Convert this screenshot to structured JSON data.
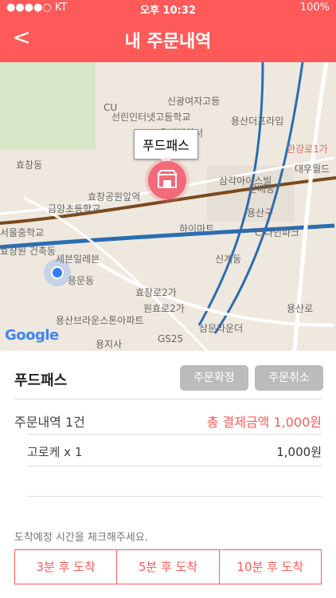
{
  "status_bar": {
    "carrier": "●●●●○ KT",
    "time": "오후 10:32",
    "battery": "100%"
  },
  "header": {
    "back_icon": "<",
    "title": "내 주문내역"
  },
  "map": {
    "place_label": "푸드패스",
    "attribution": "Google",
    "labels": [
      "신광여자고등",
      "선린인터넷고등학교",
      "용산경찰서",
      "용산더프라임",
      "효창동",
      "삼각아이스빌",
      "금양초등학교",
      "효창공원앞역",
      "문배동",
      "용산구",
      "서울중학교",
      "효창원 건축동",
      "세븐일레븐",
      "용문동",
      "하이마트",
      "신계동",
      "CJ나인파크",
      "효창로2가",
      "원효로2가",
      "CU",
      "GS25",
      "용산브라운스톤아파트",
      "용지사",
      "한강로1가",
      "대우월드",
      "용산로",
      "삼문라운더"
    ]
  },
  "order": {
    "shop_name": "푸드패스",
    "confirm_label": "주문확정",
    "cancel_label": "주문취소",
    "count_label": "주문내역 1건",
    "total_label": "총 결제금액 1,000원",
    "items": [
      {
        "name": "고로케 x 1",
        "price": "1,000원"
      }
    ],
    "arrival_hint": "도착예정 시간을 체크해주세요.",
    "arrival_options": [
      "3분 후 도착",
      "5분 후 도착",
      "10분 후 도착"
    ]
  },
  "colors": {
    "accent": "#ff5a5a",
    "pin": "#f26a7a",
    "gray_button": "#bbbbbb"
  }
}
